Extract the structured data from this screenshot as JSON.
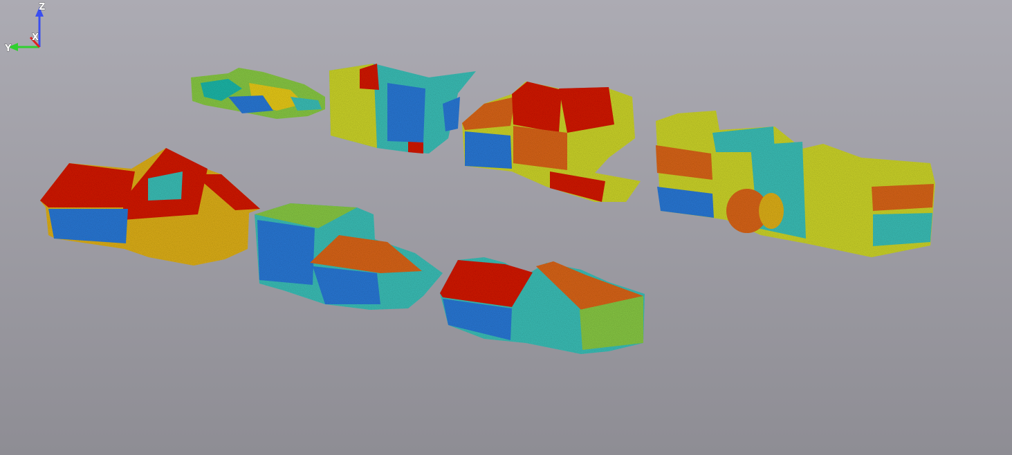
{
  "viewer": {
    "background_top": "#acabb3",
    "background_bottom": "#8e8d94"
  },
  "scene": {
    "objects": [
      {
        "id": "building-1",
        "colors": [
          "#22c0b0",
          "#8fd24a",
          "#f2d31c"
        ]
      },
      {
        "id": "building-2",
        "colors": [
          "#2f7fe0",
          "#40c8c0",
          "#d6de2e",
          "#dd1d10"
        ]
      },
      {
        "id": "building-3",
        "colors": [
          "#d6de2e",
          "#e36a1a",
          "#dd1d10",
          "#2f7fe0"
        ]
      },
      {
        "id": "building-4",
        "colors": [
          "#d6de2e",
          "#40c8c0",
          "#e36a1a",
          "#2f7fe0"
        ]
      },
      {
        "id": "building-5",
        "colors": [
          "#dd1d10",
          "#e8b81e",
          "#2f7fe0"
        ]
      },
      {
        "id": "building-6",
        "colors": [
          "#2f7fe0",
          "#40c8c0",
          "#e36a1a"
        ]
      },
      {
        "id": "building-7",
        "colors": [
          "#dd1d10",
          "#40c8c0",
          "#e36a1a",
          "#2f7fe0"
        ]
      }
    ]
  },
  "axes": {
    "z_label": "Z",
    "y_label": "Y",
    "x_label": "X",
    "z_color": "#3a4ef0",
    "y_color": "#2fd12f",
    "x_color": "#e02020"
  }
}
